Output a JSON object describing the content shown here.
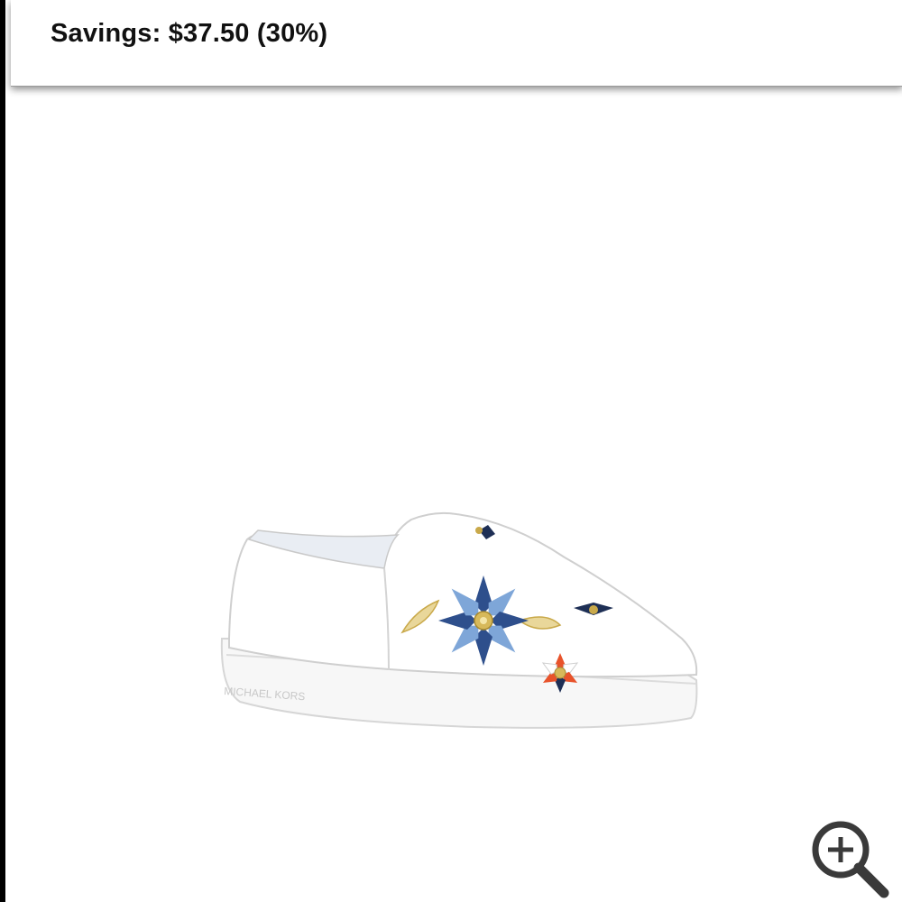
{
  "header": {
    "title_partial": "r  · . .            .        ·                     g    ",
    "savings": "Savings: $37.50 (30%)"
  },
  "product": {
    "image_alt": "White slip-on sneaker with floral appliqué",
    "sole_brand_text": "MICHAEL KORS"
  },
  "zoom": {
    "icon": "zoom-in-icon"
  },
  "colors": {
    "flower_light_blue": "#7ea6d8",
    "flower_dark_blue": "#2e4f8c",
    "flower_orange": "#e8532b",
    "gold": "#c9a94a"
  }
}
